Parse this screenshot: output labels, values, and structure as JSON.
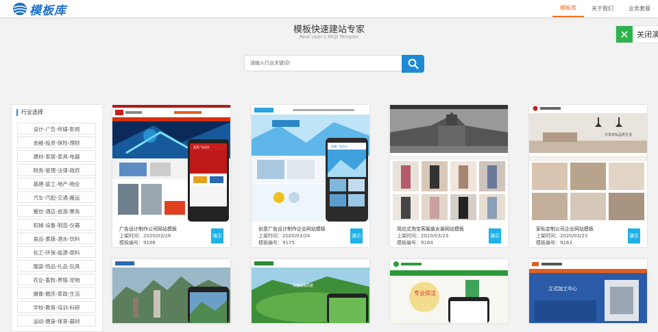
{
  "brand": {
    "name": "模板库"
  },
  "nav": {
    "items": [
      "模板库",
      "关于我们",
      "业务套餐"
    ]
  },
  "hero": {
    "title": "模板快速建站专家",
    "subtitle": "Real User's MUJI Templet"
  },
  "close": {
    "label": "关闭演"
  },
  "search": {
    "placeholder": "请输入行业关键词！"
  },
  "sidebar": {
    "title": "行业选择",
    "items": [
      "设计-广告-传媒-影视",
      "金融-投资-保险-理财",
      "建材-家居-家具-电器",
      "财务-管理-法律-政府",
      "基建-装工-地产-物业",
      "汽车-汽配-交通-搬运",
      "餐饮-酒店-旅游-票务",
      "机械-设备-制造-仪器",
      "食品-果蔬-酒水-饮料",
      "化工-环保-能源-原料",
      "服装-饰品-礼品-玩具",
      "农业-畜牧-养殖-宠物",
      "摄像-婚庆-家政-生活",
      "学校-教育-培训-科研",
      "运动-健身-体育-器材"
    ]
  },
  "cards": [
    {
      "title": "广告设计制作公司网站模板",
      "date": "上架时间：2020/03/26",
      "code": "模板编号：9186",
      "demo": "演示",
      "brand": "某某广告设计"
    },
    {
      "title": "创意广告设计制作企业网站模板",
      "date": "上架时间：2020/03/24",
      "code": "模板编号：9175",
      "demo": "演示",
      "brand": "创意广告设计"
    },
    {
      "title": "简应式淘宝客服装女装网站模板",
      "date": "上架时间：2020/03/23",
      "code": "模板编号：9164",
      "demo": "演示",
      "brand": ""
    },
    {
      "title": "家私定制公司企业网站模板",
      "date": "上架时间：2020/03/23",
      "code": "模板编号：9163",
      "demo": "演示",
      "brand": "家私定制公司"
    },
    {
      "title": "",
      "date": "",
      "code": "",
      "demo": "",
      "brand": "某某地产"
    },
    {
      "title": "",
      "date": "",
      "code": "",
      "demo": "",
      "brand": "某某球场公司"
    },
    {
      "title": "",
      "date": "",
      "code": "",
      "demo": "",
      "brand": "某某保洁公司"
    },
    {
      "title": "",
      "date": "",
      "code": "",
      "demo": "",
      "brand": "某某加工公司"
    }
  ],
  "thumb_text": {
    "c1_brand_ad": "某某广告设计",
    "c2_mobile": "创意广告设计",
    "c4_slogan": "乐享家私品质生活",
    "c6_hero": "绿茵球场风景",
    "c7_hero": "专业保洁",
    "c8_hero": "立式加工中心"
  },
  "colors": {
    "accent": "#1e8ad6",
    "nav_active": "#f07020",
    "close": "#2db34a",
    "demo": "#1eb2e8"
  }
}
